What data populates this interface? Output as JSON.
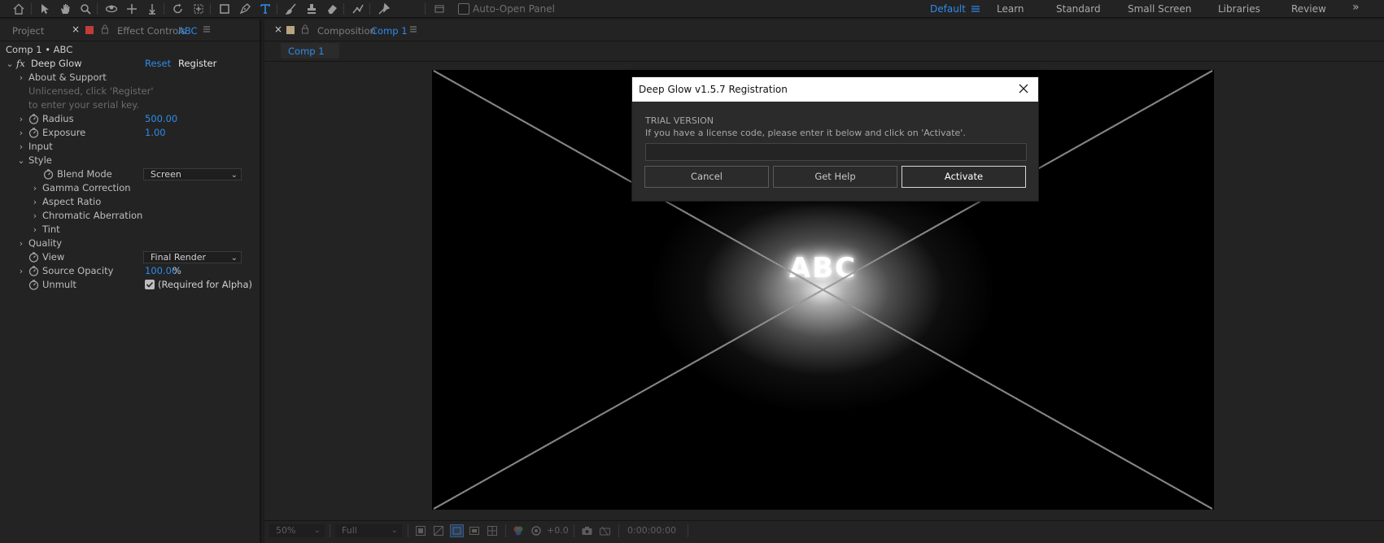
{
  "toolbar": {
    "auto_open_panel_label": "Auto-Open Panel",
    "auto_open_panel_checked": false,
    "workspaces": [
      "Default",
      "Learn",
      "Standard",
      "Small Screen",
      "Libraries",
      "Review"
    ],
    "active_workspace": "Default",
    "overflow_glyph": "»",
    "active_tool": "type-tool-icon"
  },
  "left_panel": {
    "tabs": {
      "project": "Project",
      "effect_controls": "Effect Controls",
      "effect_controls_layer": "ABC"
    },
    "breadcrumb": "Comp 1 • ABC",
    "effect": {
      "fx_glyph": "fx",
      "name": "Deep Glow",
      "reset_label": "Reset",
      "register_label": "Register"
    },
    "rows": {
      "about": "About & Support",
      "unlicensed_line1": "Unlicensed, click 'Register'",
      "unlicensed_line2": "to enter your serial key.",
      "radius": "Radius",
      "radius_value": "500.00",
      "exposure": "Exposure",
      "exposure_value": "1.00",
      "input": "Input",
      "style": "Style",
      "blend_mode": "Blend Mode",
      "blend_mode_value": "Screen",
      "gamma": "Gamma Correction",
      "aspect": "Aspect Ratio",
      "chromatic": "Chromatic Aberration",
      "tint": "Tint",
      "quality": "Quality",
      "view": "View",
      "view_value": "Final Render",
      "source_opacity": "Source Opacity",
      "source_opacity_value": "100.00",
      "source_opacity_unit": "%",
      "unmult": "Unmult",
      "unmult_note": "(Required for Alpha)",
      "unmult_checked": true
    }
  },
  "viewer": {
    "panel_label": "Composition",
    "comp_name": "Comp 1",
    "comp_tab": "Comp 1",
    "canvas_text": "ABC",
    "bottom_bar": {
      "zoom": "50%",
      "resolution": "Full",
      "exposure_value": "+0.0",
      "timecode": "0:00:00:00"
    }
  },
  "dialog": {
    "title": "Deep Glow v1.5.7 Registration",
    "trial_label": "TRIAL VERSION",
    "instructions": "If you have a license code, please enter it below and click on 'Activate'.",
    "license_input_value": "",
    "cancel_label": "Cancel",
    "help_label": "Get Help",
    "activate_label": "Activate"
  },
  "colors": {
    "accent": "#2d8ceb",
    "panel_bg": "#232323",
    "app_bg": "#1d1d1d",
    "canvas_bg": "#000000",
    "dialog_bg": "#2b2b2b",
    "dialog_title_bg": "#ffffff",
    "comp_label_swatch": "#b8a57e",
    "effect_label_swatch": "#c23b3b"
  }
}
